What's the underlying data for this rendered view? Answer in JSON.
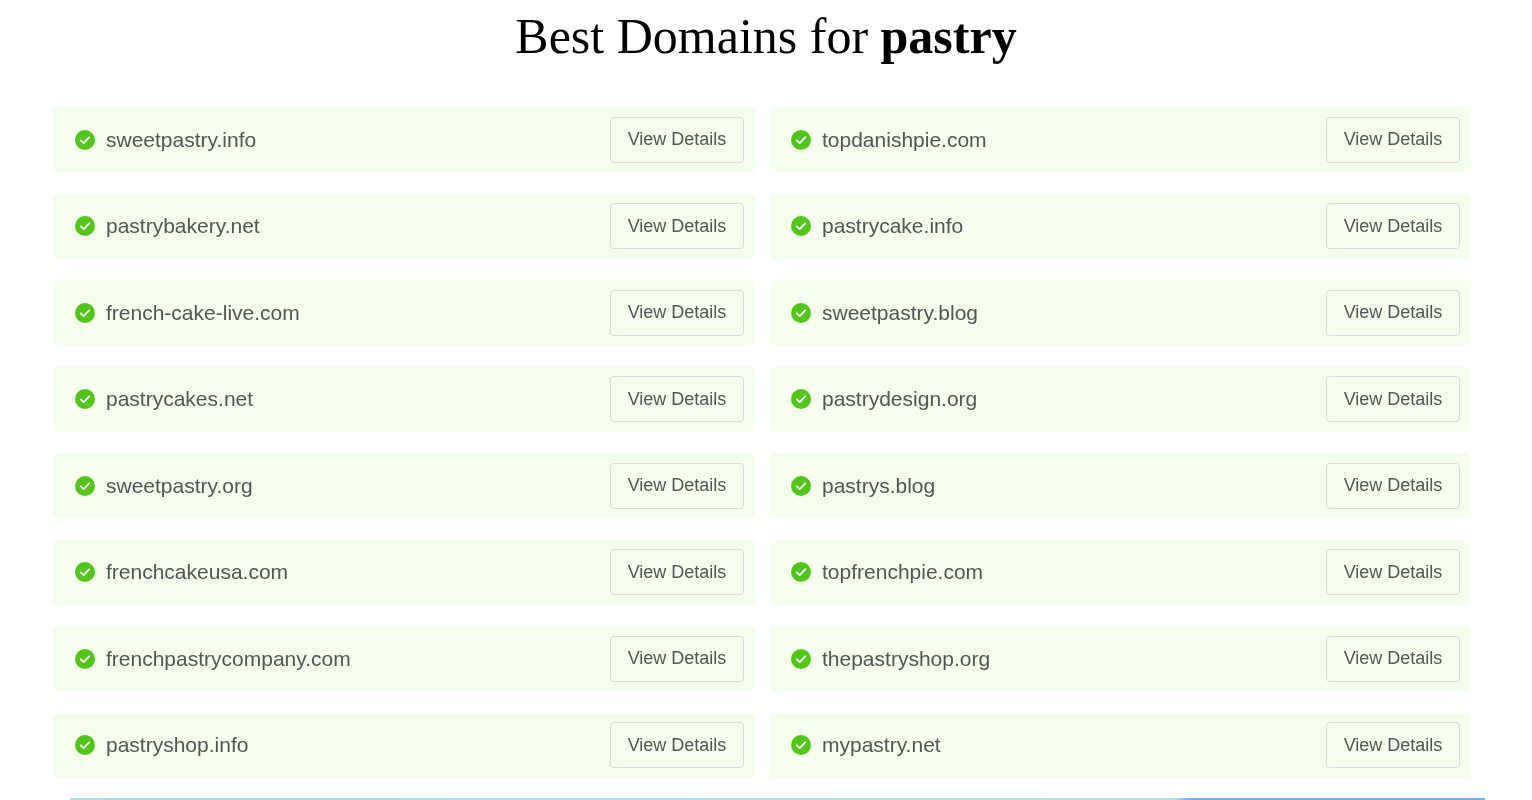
{
  "heading": "Best Domains for **pastry**",
  "domains": [
    {
      "name": "sweetpastry.info",
      "available": true,
      "button": "View Details"
    },
    {
      "name": "topdanishpie.com",
      "available": true,
      "button": "View Details"
    },
    {
      "name": "pastrybakery.net",
      "available": true,
      "button": "View Details"
    },
    {
      "name": "pastrycake.info",
      "available": true,
      "button": "View Details"
    },
    {
      "name": "french-cake-live.com",
      "available": true,
      "button": "View Details"
    },
    {
      "name": "sweetpastry.blog",
      "available": true,
      "button": "View Details"
    },
    {
      "name": "pastrycakes.net",
      "available": true,
      "button": "View Details"
    },
    {
      "name": "pastrydesign.org",
      "available": true,
      "button": "View Details"
    },
    {
      "name": "sweetpastry.org",
      "available": true,
      "button": "View Details"
    },
    {
      "name": "pastrys.blog",
      "available": true,
      "button": "View Details"
    },
    {
      "name": "frenchcakeusa.com",
      "available": true,
      "button": "View Details"
    },
    {
      "name": "topfrenchpie.com",
      "available": true,
      "button": "View Details"
    },
    {
      "name": "frenchpastrycompany.com",
      "available": true,
      "button": "View Details"
    },
    {
      "name": "thepastryshop.org",
      "available": true,
      "button": "View Details"
    },
    {
      "name": "pastryshop.info",
      "available": true,
      "button": "View Details"
    },
    {
      "name": "mypastry.net",
      "available": true,
      "button": "View Details"
    }
  ]
}
